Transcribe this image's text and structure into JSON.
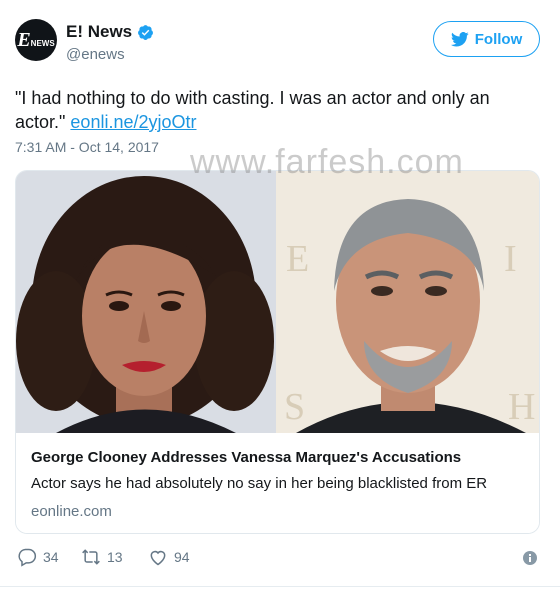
{
  "account": {
    "display_name": "E! News",
    "handle": "@enews",
    "avatar_text_e": "E",
    "avatar_text_news": "NEWS"
  },
  "follow_button": {
    "label": "Follow"
  },
  "tweet": {
    "text": "\"I had nothing to do with casting. I was an actor and only an actor.\" ",
    "link": "eonli.ne/2yjoOtr",
    "timestamp": "7:31 AM - Oct 14, 2017"
  },
  "watermark": "www.farfesh.com",
  "card": {
    "title": "George Clooney Addresses Vanessa Marquez's Accusations",
    "description": "Actor says he had absolutely no say in her being blacklisted from ER",
    "domain": "eonline.com"
  },
  "actions": {
    "replies": "34",
    "retweets": "13",
    "likes": "94"
  },
  "icons": {
    "verified": "verified-badge-icon",
    "follow": "twitter-bird-icon",
    "reply": "reply-icon",
    "retweet": "retweet-icon",
    "like": "heart-icon",
    "info": "info-icon"
  },
  "colors": {
    "accent": "#1da1f2",
    "link": "#1b95e0",
    "muted": "#657786",
    "text": "#14171a"
  }
}
